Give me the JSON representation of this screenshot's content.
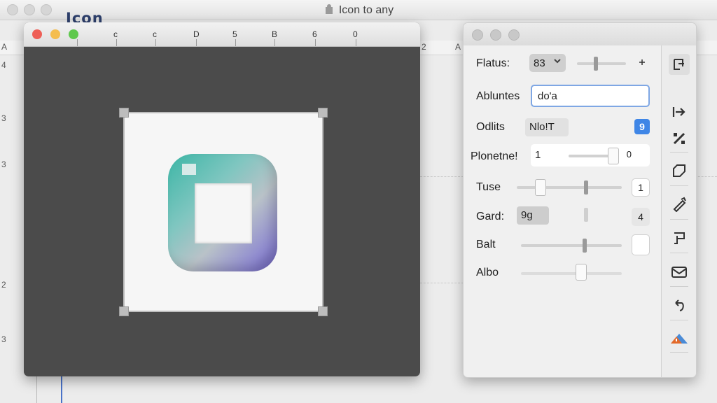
{
  "host_window": {
    "title": "Icon to any",
    "logo_text": "Icon",
    "ruler_labels": [
      "A",
      "2",
      "A"
    ],
    "margin_labels": [
      "4",
      "3",
      "3",
      "2",
      "3"
    ]
  },
  "canvas_window": {
    "ruler_labels": [
      "c",
      "c",
      "D",
      "5",
      "B",
      "6",
      "0"
    ]
  },
  "inspector": {
    "rows": {
      "flatus": {
        "label": "Flatus:",
        "value": "83",
        "plus_icon": "plus-icon"
      },
      "abluntes": {
        "label": "Abluntes",
        "value": "do'a"
      },
      "odlits": {
        "label": "Odlits",
        "value": "Nlo!T",
        "badge": "9"
      },
      "plonetne": {
        "label": "Plonetne!",
        "value": "1",
        "unit": "0"
      },
      "tuse": {
        "label": "Tuse",
        "button_value": "1"
      },
      "gard": {
        "label": "Gard:",
        "value": "9g",
        "button_value": "4"
      },
      "balt": {
        "label": "Balt"
      },
      "albo": {
        "label": "Albo"
      }
    },
    "tools": [
      "align-icon",
      "arrow-right-icon",
      "magic-wand-icon",
      "shape-icon",
      "pen-icon",
      "path-icon",
      "mail-icon",
      "undo-icon",
      "warning-icon"
    ]
  }
}
